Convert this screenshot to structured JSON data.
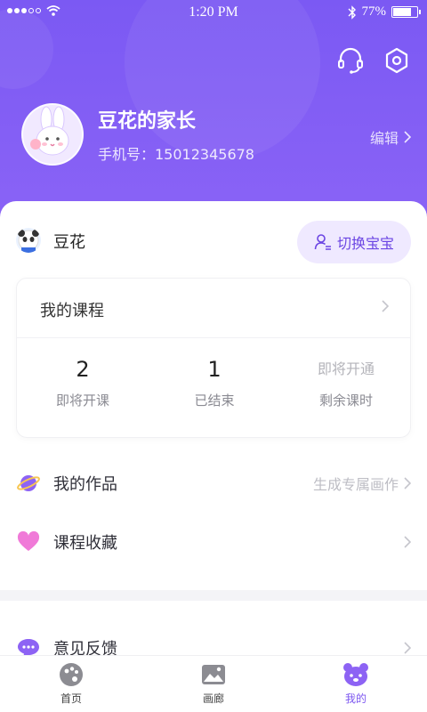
{
  "status_bar": {
    "time": "1:20 PM",
    "battery": "77%",
    "battery_level": 0.77
  },
  "header": {
    "user_name": "豆花的家长",
    "phone": "手机号：15012345678",
    "edit_label": "编辑"
  },
  "child": {
    "name": "豆花",
    "switch_label": "切换宝宝"
  },
  "courses": {
    "title": "我的课程",
    "stats": [
      {
        "value": "2",
        "label": "即将开课"
      },
      {
        "value": "1",
        "label": "已结束"
      },
      {
        "value": "即将开通",
        "label": "剩余课时"
      }
    ]
  },
  "menu": {
    "works": {
      "label": "我的作品",
      "hint": "生成专属画作"
    },
    "favorites": {
      "label": "课程收藏"
    },
    "feedback": {
      "label": "意见反馈"
    }
  },
  "tabs": [
    {
      "label": "首页"
    },
    {
      "label": "画廊"
    },
    {
      "label": "我的"
    }
  ],
  "colors": {
    "primary": "#7c56f0",
    "header": "#8a63f6",
    "switch_bg": "#efe9ff"
  }
}
